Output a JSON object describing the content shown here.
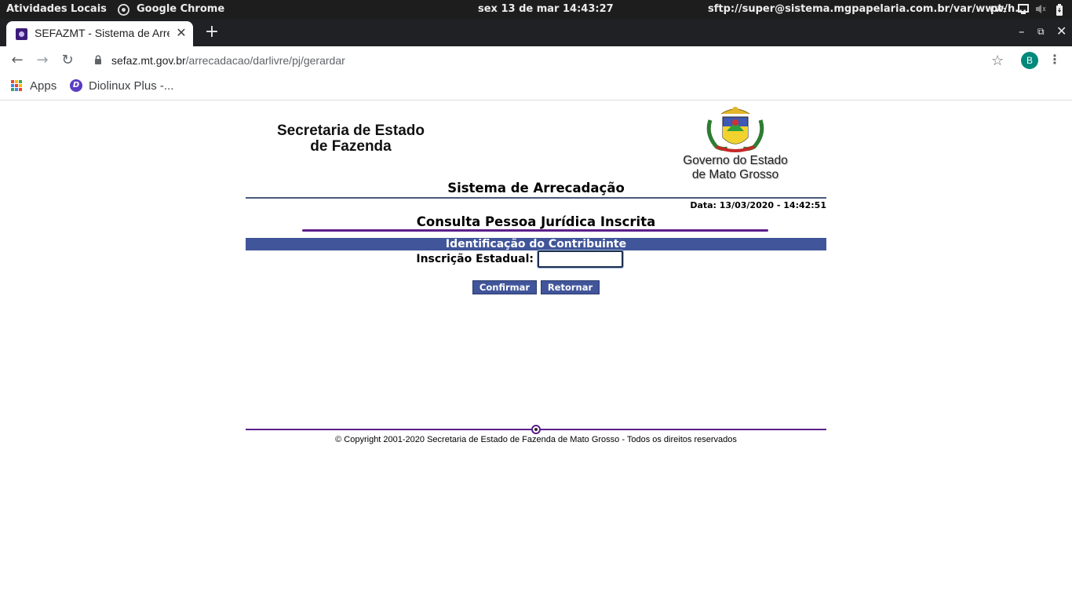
{
  "system_bar": {
    "activities": "Atividades",
    "places": "Locais",
    "app_name": "Google Chrome",
    "clock": "sex 13 de mar  14:43:27",
    "window_title": "sftp://super@sistema.mgpapelaria.com.br/var/www/h...",
    "locale": "pt₁"
  },
  "browser": {
    "tab_title": "SEFAZMT - Sistema de Arrecadação",
    "url_host": "sefaz.mt.gov.br",
    "url_path": "/arrecadacao/darlivre/pj/gerardar",
    "profile_initial": "B",
    "bookmarks": [
      {
        "label": "Apps"
      },
      {
        "label": "Diolinux Plus -..."
      }
    ]
  },
  "page": {
    "brand_left_line1": "Secretaria de Estado",
    "brand_left_line2": "de Fazenda",
    "brand_right_line1": "Governo do Estado",
    "brand_right_line2": "de Mato Grosso",
    "system_title": "Sistema de Arrecadação",
    "date_text": "Data: 13/03/2020 - 14:42:51",
    "page_title": "Consulta Pessoa Jurídica Inscrita",
    "section_title": "Identificação do Contribuinte",
    "field_label": "Inscrição Estadual:",
    "field_value": "",
    "confirm_label": "Confirmar",
    "return_label": "Retornar",
    "copyright": "© Copyright 2001-2020 Secretaria de Estado de Fazenda de Mato Grosso - Todos os direitos reservados"
  },
  "colors": {
    "section_bar": "#41559a",
    "accent_rule": "#5b1f8c",
    "avatar": "#00897b"
  }
}
